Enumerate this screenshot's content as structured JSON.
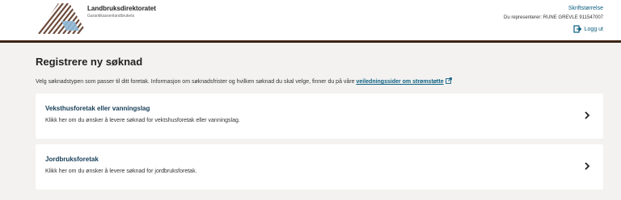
{
  "header": {
    "org_name": "Landbruksdirektoratet",
    "org_sub": "Garantikassenlandbrukets",
    "font_size_link": "Skriftstørrelse",
    "representing": "Du representerer: RUNE GREVLE 911547007",
    "logout": "Logg ut"
  },
  "main": {
    "title": "Registrere ny søknad",
    "intro_text": "Velg søknadstypen som passer til ditt foretak. Informasjon om søknadsfrister og hvilken søknad du skal velge, finner du på våre ",
    "intro_link": "veiledningssider om strømstøtte",
    "cards": [
      {
        "title": "Veksthusforetak eller vanningslag",
        "description": "Klikk her om du ønsker å levere søknad for vektshusforetak eller vanningslag."
      },
      {
        "title": "Jordbruksforetak",
        "description": "Klikk her om du ønsker å levere søknad for jordbruksforetak."
      }
    ]
  },
  "colors": {
    "brand_bar": "#3b2416",
    "link": "#0a5d7e",
    "card_title": "#153d56",
    "background": "#f3f2f1"
  },
  "icons": [
    "logo-stripes",
    "logout-icon",
    "external-link-icon",
    "chevron-right-icon"
  ]
}
